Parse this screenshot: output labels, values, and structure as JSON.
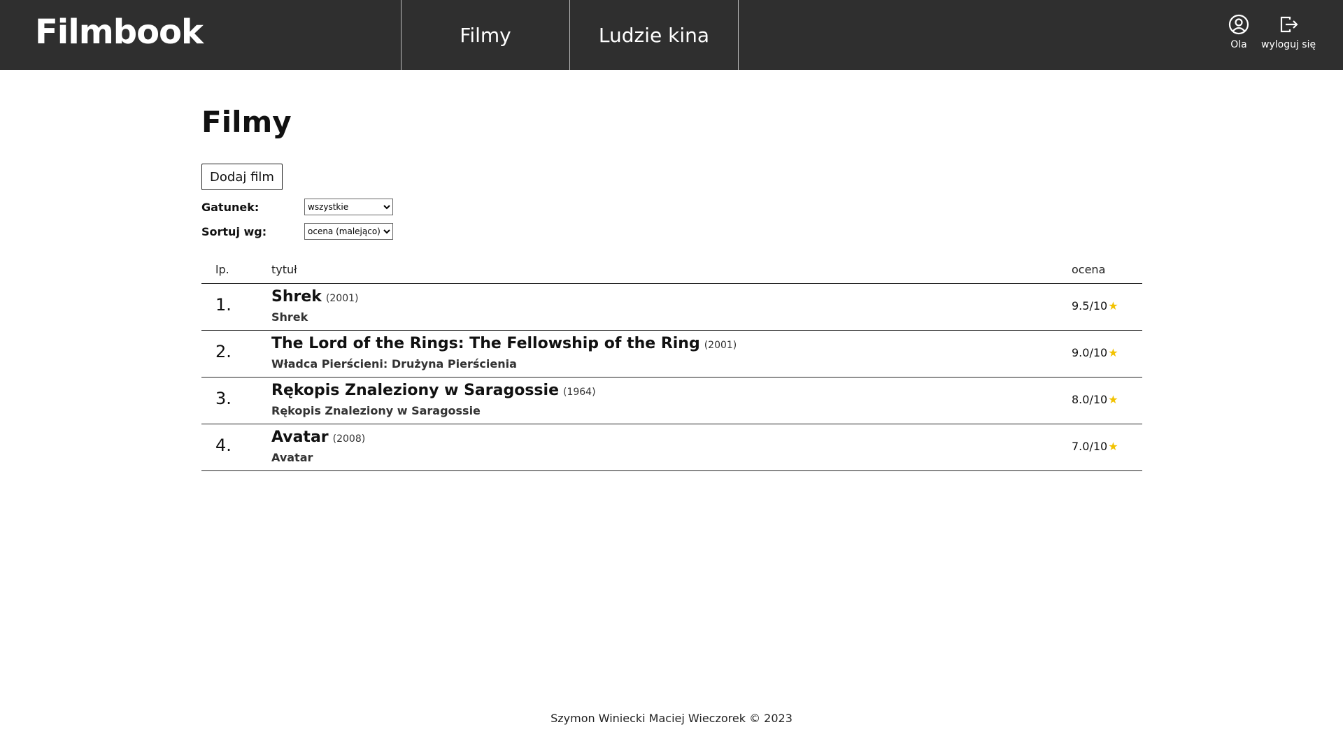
{
  "header": {
    "logo": "Filmbook",
    "nav": [
      {
        "label": "Filmy"
      },
      {
        "label": "Ludzie kina"
      }
    ],
    "user": {
      "name": "Ola",
      "logout_label": "wyloguj się"
    }
  },
  "main": {
    "title": "Filmy",
    "add_button": "Dodaj film",
    "filters": {
      "genre_label": "Gatunek:",
      "genre_value": "wszystkie",
      "sort_label": "Sortuj wg:",
      "sort_value": "ocena (malejąco)"
    },
    "table": {
      "headers": {
        "lp": "lp.",
        "title": "tytuł",
        "rating": "ocena"
      },
      "rows": [
        {
          "num": "1.",
          "title": "Shrek",
          "year": "(2001)",
          "original": "Shrek",
          "rating": "9.5/10"
        },
        {
          "num": "2.",
          "title": "The Lord of the Rings: The Fellowship of the Ring",
          "year": "(2001)",
          "original": "Władca Pierścieni: Drużyna Pierścienia",
          "rating": "9.0/10"
        },
        {
          "num": "3.",
          "title": "Rękopis Znaleziony w Saragossie",
          "year": "(1964)",
          "original": "Rękopis Znaleziony w Saragossie",
          "rating": "8.0/10"
        },
        {
          "num": "4.",
          "title": "Avatar",
          "year": "(2008)",
          "original": "Avatar",
          "rating": "7.0/10"
        }
      ]
    }
  },
  "footer": {
    "text": "Szymon Winiecki Maciej Wieczorek © 2023"
  },
  "colors": {
    "header_bg": "#2f2f2f",
    "star": "#f2c200"
  }
}
